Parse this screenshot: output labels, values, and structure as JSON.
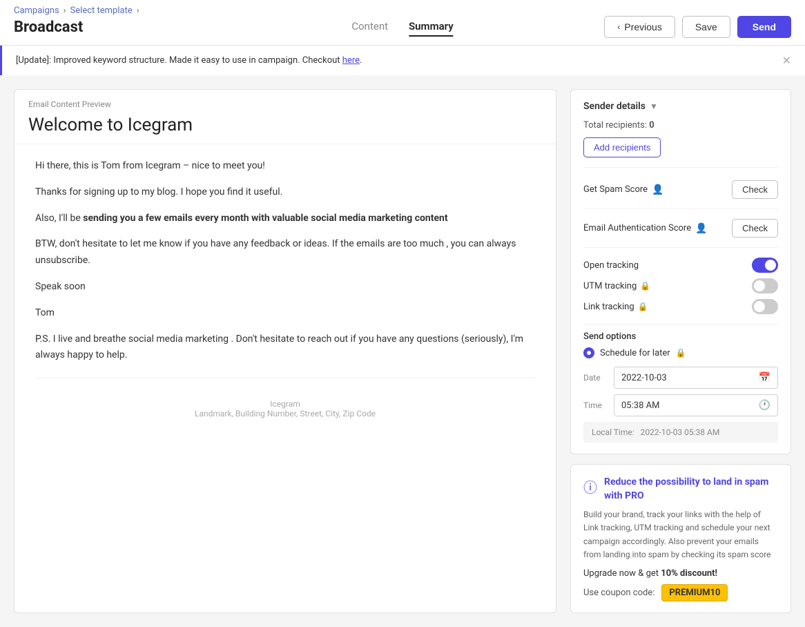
{
  "breadcrumb": {
    "campaigns": "Campaigns",
    "select_template": "Select template",
    "sep": "›"
  },
  "page_title": "Broadcast",
  "tabs": [
    {
      "id": "content",
      "label": "Content",
      "active": false
    },
    {
      "id": "summary",
      "label": "Summary",
      "active": true
    }
  ],
  "header_actions": {
    "previous_label": "Previous",
    "save_label": "Save",
    "send_label": "Send"
  },
  "notification": {
    "text": "[Update]: Improved keyword structure. Made it easy to use in campaign. Checkout ",
    "link_text": "here",
    "link": "#"
  },
  "email_preview": {
    "section_label": "Email Content Preview",
    "subject": "Welcome to Icegram",
    "body_paragraphs": [
      "Hi there, this is Tom from Icegram – nice to meet you!",
      "Thanks for signing up to my blog. I hope you find it useful.",
      "Also, I'll be sending you a few emails every month with valuable social media marketing content",
      "BTW, don't hesitate to let me know if you have any feedback or ideas. If the emails are too much , you can always unsubscribe.",
      "Speak soon",
      "Tom",
      "P.S. I live and breathe social media marketing . Don't hesitate to reach out if you have any questions (seriously), I'm always happy to help."
    ],
    "bold_text": "sending you a few emails every month with valuable social media marketing content",
    "footer_company": "Icegram",
    "footer_address": "Landmark, Building Number, Street, City, Zip Code"
  },
  "sender_details": {
    "title": "Sender details",
    "total_recipients_label": "Total recipients:",
    "total_recipients_count": "0",
    "add_recipients_label": "Add recipients"
  },
  "spam_score": {
    "label": "Get Spam Score",
    "check_label": "Check"
  },
  "auth_score": {
    "label": "Email Authentication Score",
    "check_label": "Check"
  },
  "tracking": {
    "open_tracking_label": "Open tracking",
    "open_tracking_enabled": true,
    "utm_tracking_label": "UTM tracking",
    "utm_tracking_enabled": false,
    "link_tracking_label": "Link tracking",
    "link_tracking_enabled": false
  },
  "send_options": {
    "label": "Send options",
    "schedule_label": "Schedule for later"
  },
  "schedule": {
    "date_label": "Date",
    "date_value": "2022-10-03",
    "time_label": "Time",
    "time_value": "05:38 AM",
    "local_time_label": "Local Time:",
    "local_time_value": "2022-10-03 05:38 AM"
  },
  "pro_card": {
    "title": "Reduce the possibility to land in spam with PRO",
    "description": "Build your brand, track your links with the help of Link tracking, UTM tracking and schedule your next campaign accordingly. Also prevent your emails from landing into spam by checking its spam score",
    "upgrade_text": "Upgrade now & get ",
    "discount": "10% discount!",
    "coupon_prefix": "Use coupon code:",
    "coupon_code": "PREMIUM10"
  }
}
